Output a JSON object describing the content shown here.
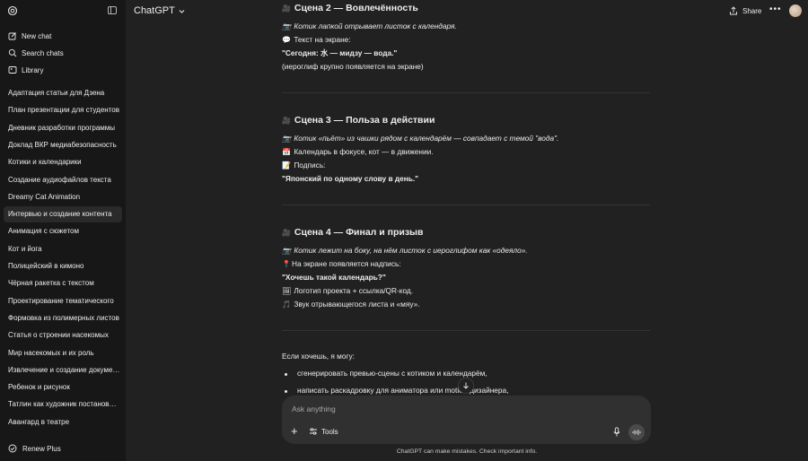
{
  "sidebar": {
    "new_chat": "New chat",
    "search_chats": "Search chats",
    "library": "Library",
    "chats": [
      "Адаптация статьи для Дзена",
      "План презентации для студентов",
      "Дневник разработки программы",
      "Доклад ВКР медиабезопасность",
      "Котики и календарики",
      "Создание аудиофайлов текста",
      "Dreamy Cat Animation",
      "Интервью и создание контента",
      "Анимация с сюжетом",
      "Кот и йога",
      "Полицейский в кимоно",
      "Чёрная ракетка с текстом",
      "Проектирование тематического",
      "Формовка из полимерных листов",
      "Статья о строении насекомых",
      "Мир насекомых и их роль",
      "Извлечение и создание документа",
      "Ребенок и рисунок",
      "Татлин как художник постановщик",
      "Авангард в театре"
    ],
    "renew": "Renew Plus"
  },
  "header": {
    "model": "ChatGPT",
    "share": "Share"
  },
  "message": {
    "scene2_title": "Сцена 2 — Вовлечённость",
    "scene2_line1": "Котик лапкой отрывает листок с календаря.",
    "scene2_line2": "Текст на экране:",
    "scene2_line3": "\"Сегодня: 水 — мидзу — вода.\"",
    "scene2_line4": "(иероглиф крупно появляется на экране)",
    "scene3_title": "Сцена 3 — Польза в действии",
    "scene3_line1": "Котик «пьёт» из чашки рядом с календарём — совпадает с темой \"вода\".",
    "scene3_line2": "Календарь в фокусе, кот — в движении.",
    "scene3_line3": "Подпись:",
    "scene3_line4": "\"Японский по одному слову в день.\"",
    "scene4_title": "Сцена 4 — Финал и призыв",
    "scene4_line1": "Котик лежит на боку, на нём листок с иероглифом как «одеяло».",
    "scene4_line2": "На экране появляется надпись:",
    "scene4_line3": "\"Хочешь такой календарь?\"",
    "scene4_line4": "Логотип проекта + ссылка/QR-код.",
    "scene4_line5": "Звук отрывающегося листа и «мяу».",
    "offer_intro": "Если хочешь, я могу:",
    "offer_items": [
      "сгенерировать превью-сцены с котиком и календарём,",
      "написать раскадровку для аниматора или motion-дизайнера,"
    ]
  },
  "composer": {
    "placeholder": "Ask anything",
    "tools": "Tools"
  },
  "disclaimer": "ChatGPT can make mistakes. Check important info.",
  "icons": {
    "scene": "🎥",
    "camera": "📷",
    "speech": "💬",
    "calendar": "📅",
    "memo": "📝",
    "pin": "📍",
    "frame": "🖼",
    "music": "🎵"
  }
}
